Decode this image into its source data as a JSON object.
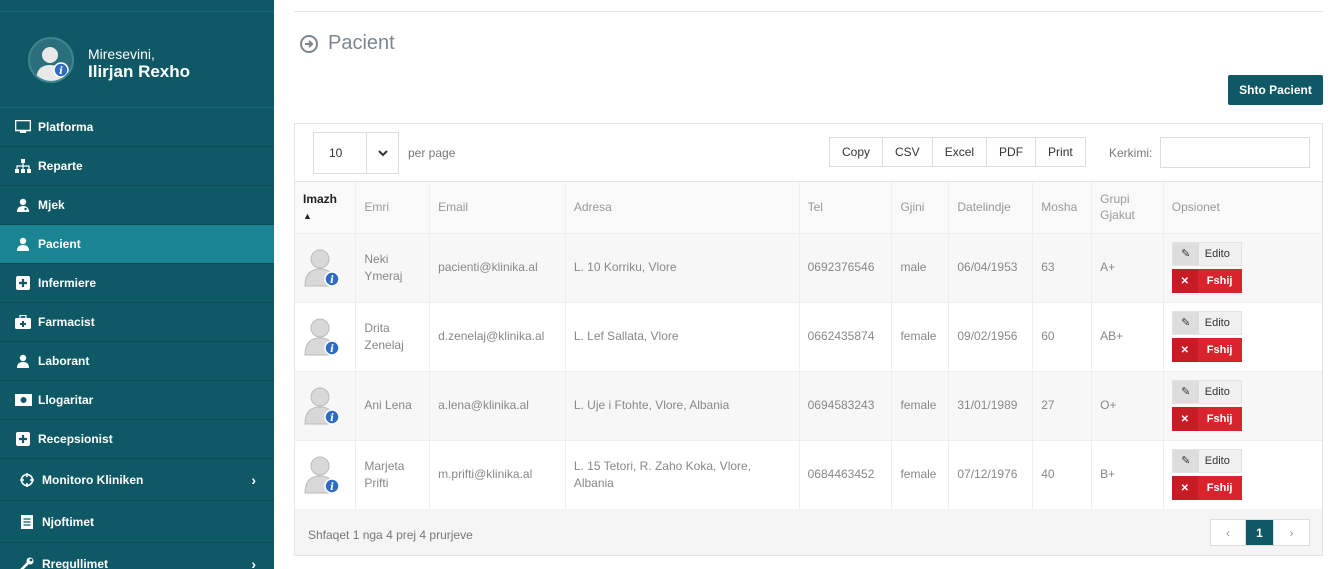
{
  "user": {
    "greeting": "Miresevini,",
    "name": "Ilirjan Rexho"
  },
  "nav": [
    {
      "label": "Platforma",
      "icon": "monitor-icon"
    },
    {
      "label": "Reparte",
      "icon": "sitemap-icon"
    },
    {
      "label": "Mjek",
      "icon": "user-md-icon"
    },
    {
      "label": "Pacient",
      "icon": "user-icon"
    },
    {
      "label": "Infermiere",
      "icon": "plus-square-icon"
    },
    {
      "label": "Farmacist",
      "icon": "medkit-icon"
    },
    {
      "label": "Laborant",
      "icon": "user-icon"
    },
    {
      "label": "Llogaritar",
      "icon": "money-icon"
    },
    {
      "label": "Recepsionist",
      "icon": "plus-square-icon"
    },
    {
      "label": "Monitoro Kliniken",
      "icon": "crosshair-icon"
    },
    {
      "label": "Njoftimet",
      "icon": "document-icon"
    },
    {
      "label": "Rregullimet",
      "icon": "wrench-icon"
    }
  ],
  "page": {
    "title": "Pacient",
    "add_button": "Shto Pacient"
  },
  "controls": {
    "per_page_value": "10",
    "per_page_label": "per page",
    "export_buttons": [
      "Copy",
      "CSV",
      "Excel",
      "PDF",
      "Print"
    ],
    "search_label": "Kerkimi:"
  },
  "table": {
    "headers": [
      "Imazh",
      "Emri",
      "Email",
      "Adresa",
      "Tel",
      "Gjini",
      "Datelindje",
      "Mosha",
      "Grupi Gjakut",
      "Opsionet"
    ],
    "rows": [
      {
        "name": "Neki Ymeraj",
        "email": "pacienti@klinika.al",
        "address": "L. 10 Korriku, Vlore",
        "tel": "0692376546",
        "gender": "male",
        "dob": "06/04/1953",
        "age": "63",
        "blood": "A+"
      },
      {
        "name": "Drita Zenelaj",
        "email": "d.zenelaj@klinika.al",
        "address": "L. Lef Sallata, Vlore",
        "tel": "0662435874",
        "gender": "female",
        "dob": "09/02/1956",
        "age": "60",
        "blood": "AB+"
      },
      {
        "name": "Ani Lena",
        "email": "a.lena@klinika.al",
        "address": "L. Uje i Ftohte, Vlore, Albania",
        "tel": "0694583243",
        "gender": "female",
        "dob": "31/01/1989",
        "age": "27",
        "blood": "O+"
      },
      {
        "name": "Marjeta Prifti",
        "email": "m.prifti@klinika.al",
        "address": "L. 15 Tetori, R. Zaho Koka, Vlore, Albania",
        "tel": "0684463452",
        "gender": "female",
        "dob": "07/12/1976",
        "age": "40",
        "blood": "B+"
      }
    ],
    "edit_label": "Edito",
    "delete_label": "Fshij"
  },
  "footer": {
    "info": "Shfaqet 1 nga 4 prej 4 prurjeve",
    "pager": [
      "‹",
      "1",
      "›"
    ]
  },
  "colors": {
    "sidebar": "#0f5866",
    "active": "#1a8493",
    "danger": "#d9232d"
  }
}
